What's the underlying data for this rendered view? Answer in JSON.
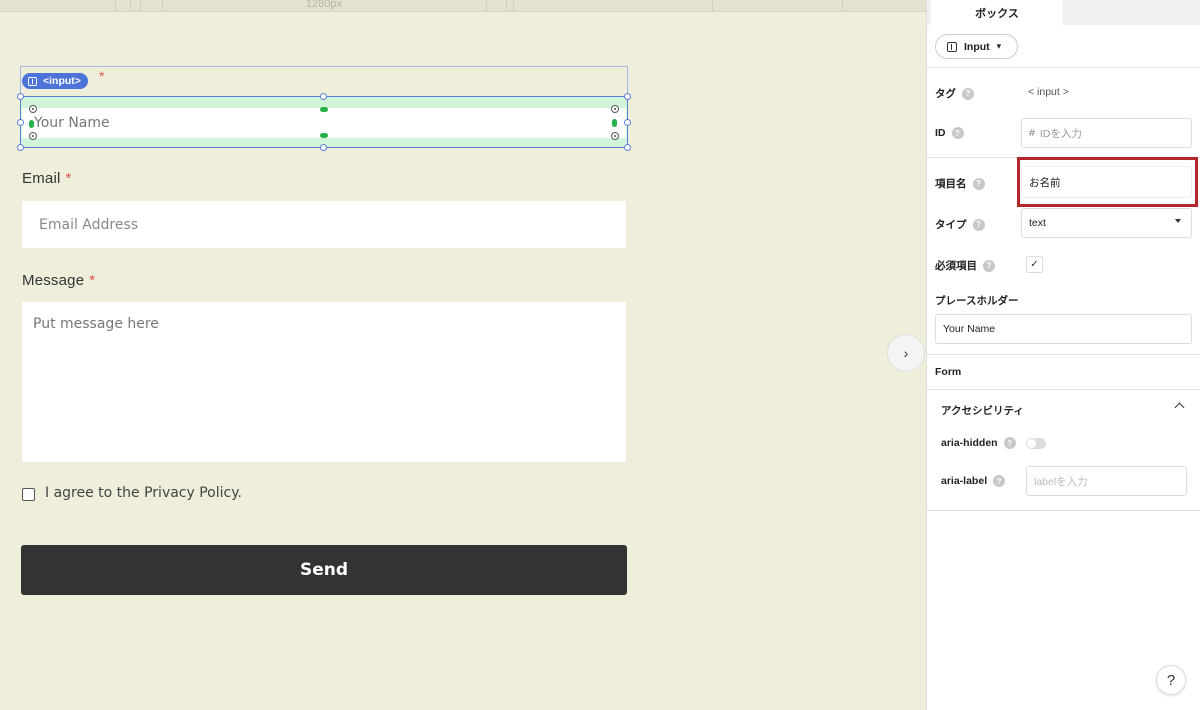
{
  "canvas": {
    "ruler_label": "1280px",
    "input_badge": "<input>",
    "required_mark": "*",
    "name_placeholder": "Your Name",
    "email_label": "Email",
    "email_placeholder": "Email Address",
    "message_label": "Message",
    "message_placeholder": "Put message here",
    "agree_label": "I agree to the Privacy Policy.",
    "send_label": "Send",
    "collapse_icon": "›"
  },
  "panel": {
    "tab_label": "ボックス",
    "element_type": "Input",
    "tag_label": "タグ",
    "tag_value": "< input >",
    "id_label": "ID",
    "id_hash": "#",
    "id_placeholder": "IDを入力",
    "name_label": "項目名",
    "name_value": "お名前",
    "type_label": "タイプ",
    "type_value": "text",
    "required_label": "必須項目",
    "required_checked": "✓",
    "placeholder_label": "プレースホルダー",
    "placeholder_value": "Your Name",
    "form_label": "Form",
    "accessibility_label": "アクセシビリティ",
    "aria_hidden_label": "aria-hidden",
    "aria_label_label": "aria-label",
    "aria_label_placeholder": "labelを入力",
    "help_icon": "?",
    "help_button": "?"
  },
  "colors": {
    "canvas_bg": "#eeeedb",
    "selection": "#5b7fd6",
    "selection_fill": "#d2f4d9",
    "badge": "#4d74d8",
    "required": "#d9534f",
    "send_bg": "#333333",
    "highlight": "#b3262a"
  }
}
